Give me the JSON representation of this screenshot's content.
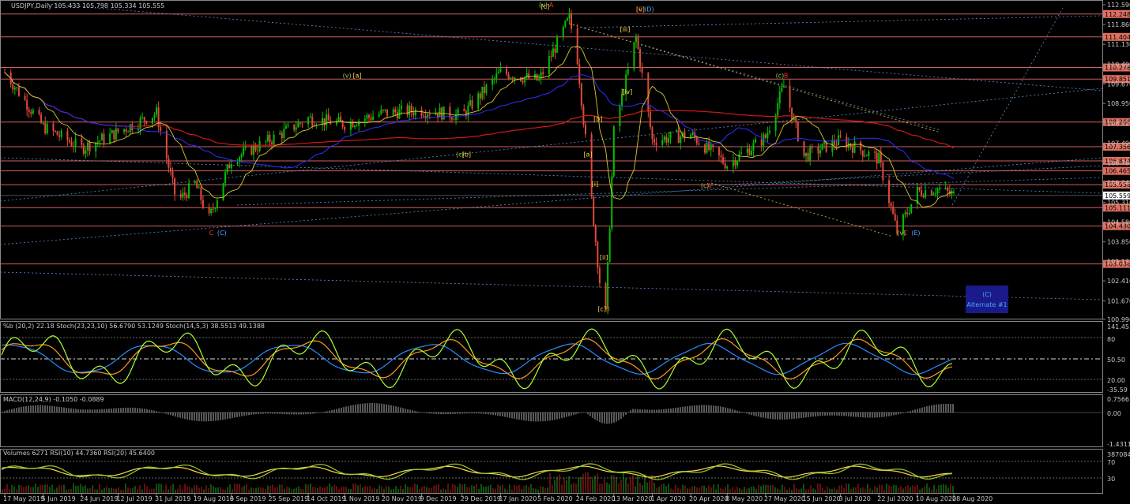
{
  "window": {
    "symbol_header": "USDJPY,Daily  105.433 105.798 105.334 105.555",
    "stoch_header": "%b (20,2) 22.18  Stoch(23,23,10) 56.6790 53.1249  Stoch(14,5,3) 38.5513 49.1388",
    "macd_header": "MACD(12,24,9) -0.1050 -0.0889",
    "vol_header": "Volumes 6271  RSI(10) 44.7360  RSI(20) 45.6400"
  },
  "colors": {
    "background": "#000000",
    "axis": "#c8c8c8",
    "bull": "#00c000",
    "bear": "#e04b3a",
    "hline": "#d06060",
    "pricebox": "#e07060",
    "ma200": "#d01818",
    "ma50": "#3030ff",
    "ma20": "#d8c830",
    "dotted": "#5f8fd0",
    "wave_green": "#8fd14f",
    "wave_yellow": "#ffd84d",
    "wave_red": "#ff3030",
    "wave_blue": "#4aa3ff",
    "stoch_fast": "#adff2f",
    "stoch_slow": "#ff9a1f",
    "stoch_blue": "#2a8cff",
    "alt_box": "#1a1a8a"
  },
  "chart_data": {
    "type": "candlestick",
    "title": "USDJPY,Daily",
    "ohlc_last": {
      "open": 105.433,
      "high": 105.798,
      "low": 105.334,
      "close": 105.555
    },
    "ylim": [
      100.99,
      112.59
    ],
    "y_ticks": [
      "112.590",
      "111.860",
      "111.130",
      "110.400",
      "109.670",
      "108.950",
      "108.220",
      "107.490",
      "106.760",
      "106.040",
      "105.310",
      "104.580",
      "103.850",
      "103.130",
      "102.410",
      "101.670",
      "100.990"
    ],
    "x_ticks": [
      "17 May 2019",
      "5 Jun 2019",
      "24 Jun 2019",
      "12 Jul 2019",
      "31 Jul 2019",
      "19 Aug 2019",
      "6 Sep 2019",
      "25 Sep 2019",
      "14 Oct 2019",
      "1 Nov 2019",
      "20 Nov 2019",
      "9 Dec 2019",
      "29 Dec 2019",
      "17 Jan 2020",
      "5 Feb 2020",
      "24 Feb 2020",
      "13 Mar 2020",
      "1 Apr 2020",
      "20 Apr 2020",
      "8 May 2020",
      "27 May 2020",
      "15 Jun 2020",
      "3 Jul 2020",
      "22 Jul 2020",
      "10 Aug 2020",
      "28 Aug 2020"
    ],
    "horizontal_levels": [
      "112.248",
      "111.404",
      "110.278",
      "109.851",
      "108.266",
      "107.356",
      "106.834",
      "106.465",
      "105.958",
      "105.111",
      "104.430",
      "103.036"
    ],
    "current_price": "105.559",
    "close_series": [
      {
        "date": "17 May 2019",
        "close": 110.1
      },
      {
        "date": "5 Jun 2019",
        "close": 108.1
      },
      {
        "date": "24 Jun 2019",
        "close": 107.3
      },
      {
        "date": "12 Jul 2019",
        "close": 107.9
      },
      {
        "date": "31 Jul 2019",
        "close": 108.6
      },
      {
        "date": "10 Aug 2019",
        "close": 105.3
      },
      {
        "date": "19 Aug 2019",
        "close": 106.0
      },
      {
        "date": "26 Aug 2019",
        "close": 104.7
      },
      {
        "date": "6 Sep 2019",
        "close": 106.9
      },
      {
        "date": "25 Sep 2019",
        "close": 107.6
      },
      {
        "date": "14 Oct 2019",
        "close": 108.4
      },
      {
        "date": "1 Nov 2019",
        "close": 108.2
      },
      {
        "date": "20 Nov 2019",
        "close": 108.6
      },
      {
        "date": "9 Dec 2019",
        "close": 108.7
      },
      {
        "date": "29 Dec 2019",
        "close": 108.5
      },
      {
        "date": "17 Jan 2020",
        "close": 110.1
      },
      {
        "date": "5 Feb 2020",
        "close": 109.8
      },
      {
        "date": "20 Feb 2020",
        "close": 112.1
      },
      {
        "date": "24 Feb 2020",
        "close": 110.6
      },
      {
        "date": "6 Mar 2020",
        "close": 102.4
      },
      {
        "date": "9 Mar 2020",
        "close": 101.2
      },
      {
        "date": "13 Mar 2020",
        "close": 107.9
      },
      {
        "date": "24 Mar 2020",
        "close": 111.4
      },
      {
        "date": "1 Apr 2020",
        "close": 107.6
      },
      {
        "date": "20 Apr 2020",
        "close": 107.8
      },
      {
        "date": "8 May 2020",
        "close": 106.7
      },
      {
        "date": "27 May 2020",
        "close": 107.7
      },
      {
        "date": "5 Jun 2020",
        "close": 109.6
      },
      {
        "date": "15 Jun 2020",
        "close": 107.0
      },
      {
        "date": "3 Jul 2020",
        "close": 107.6
      },
      {
        "date": "22 Jul 2020",
        "close": 106.9
      },
      {
        "date": "31 Jul 2020",
        "close": 104.2
      },
      {
        "date": "10 Aug 2020",
        "close": 105.7
      },
      {
        "date": "20 Aug 2020",
        "close": 105.8
      },
      {
        "date": "28 Aug 2020",
        "close": 105.559
      }
    ],
    "wave_labels": [
      {
        "date": "5 Feb 2020",
        "price": 112.5,
        "text": "(v)",
        "color": "wave_green"
      },
      {
        "date": "6 Feb 2020",
        "price": 112.45,
        "text": "[c]",
        "color": "wave_yellow"
      },
      {
        "date": "10 Feb 2020",
        "price": 112.5,
        "text": "A",
        "color": "wave_red"
      },
      {
        "date": "24 Mar 2020",
        "price": 112.35,
        "text": "[v]",
        "color": "wave_yellow"
      },
      {
        "date": "25 Mar 2020",
        "price": 112.35,
        "text": "C",
        "color": "wave_red"
      },
      {
        "date": "28 Mar 2020",
        "price": 112.35,
        "text": "(D)",
        "color": "wave_blue"
      },
      {
        "date": "16 Mar 2020",
        "price": 111.6,
        "text": "[iii]",
        "color": "wave_yellow"
      },
      {
        "date": "17 Mar 2020",
        "price": 109.3,
        "text": "[iv]",
        "color": "wave_yellow"
      },
      {
        "date": "2 Mar 2020",
        "price": 105.9,
        "text": "[i]",
        "color": "wave_yellow"
      },
      {
        "date": "3 Mar 2020",
        "price": 108.3,
        "text": "[b]",
        "color": "wave_yellow"
      },
      {
        "date": "27 Feb 2020",
        "price": 107.0,
        "text": "[a]",
        "color": "wave_yellow"
      },
      {
        "date": "6 Mar 2020",
        "price": 103.2,
        "text": "[ii]",
        "color": "wave_yellow"
      },
      {
        "date": "5 Mar 2020",
        "price": 101.3,
        "text": "[c]",
        "color": "wave_yellow"
      },
      {
        "date": "9 Mar 2020",
        "price": 101.3,
        "text": "B",
        "color": "wave_red"
      },
      {
        "date": "31 Oct 2019",
        "price": 109.9,
        "text": "(v)",
        "color": "wave_green"
      },
      {
        "date": "5 Nov 2019",
        "price": 109.9,
        "text": "[a]",
        "color": "wave_yellow"
      },
      {
        "date": "26 Dec 2019",
        "price": 107.0,
        "text": "(c)",
        "color": "wave_green"
      },
      {
        "date": "29 Dec 2019",
        "price": 107.0,
        "text": "[b]",
        "color": "wave_yellow"
      },
      {
        "date": "26 Aug 2019",
        "price": 104.1,
        "text": "C",
        "color": "wave_red"
      },
      {
        "date": "30 Aug 2019",
        "price": 104.1,
        "text": "(C)",
        "color": "wave_blue"
      },
      {
        "date": "1 Jun 2020",
        "price": 109.9,
        "text": "(c)",
        "color": "wave_green"
      },
      {
        "date": "5 Jun 2020",
        "price": 109.9,
        "text": "B",
        "color": "wave_red"
      },
      {
        "date": "25 Apr 2020",
        "price": 105.85,
        "text": "(c)",
        "color": "wave_green"
      },
      {
        "date": "28 Apr 2020",
        "price": 105.85,
        "text": "A",
        "color": "wave_red"
      },
      {
        "date": "31 Jul 2020",
        "price": 104.1,
        "text": "(v)",
        "color": "wave_green"
      },
      {
        "date": "3 Aug 2020",
        "price": 104.1,
        "text": "C",
        "color": "wave_red"
      },
      {
        "date": "7 Aug 2020",
        "price": 104.1,
        "text": "(E)",
        "color": "wave_blue"
      }
    ],
    "alternate_box": {
      "line1": "(C)",
      "line2": "Alternate #1"
    },
    "indicators": {
      "stoch_scale": [
        "141.45",
        "80",
        "50.50",
        "20.00",
        "-35.59"
      ],
      "macd_scale": [
        "0.7566",
        "0.00",
        "-1.4311"
      ],
      "volume_scale": [
        "387084",
        "70",
        "30"
      ]
    }
  }
}
